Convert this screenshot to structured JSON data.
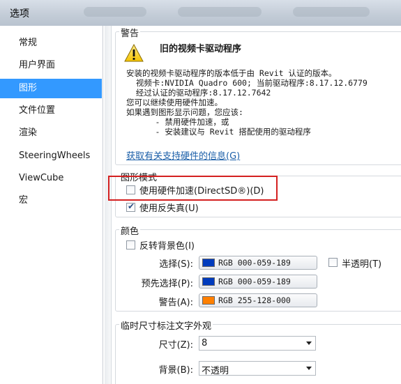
{
  "window": {
    "title": "选项"
  },
  "sidebar": {
    "items": [
      {
        "label": "常规",
        "selected": false
      },
      {
        "label": "用户界面",
        "selected": false
      },
      {
        "label": "图形",
        "selected": true
      },
      {
        "label": "文件位置",
        "selected": false
      },
      {
        "label": "渲染",
        "selected": false
      },
      {
        "label": "SteeringWheels",
        "selected": false
      },
      {
        "label": "ViewCube",
        "selected": false
      },
      {
        "label": "宏",
        "selected": false
      }
    ]
  },
  "warning": {
    "group_title": "警告",
    "icon": "warning-triangle-icon",
    "heading": "旧的视频卡驱动程序",
    "lines": [
      "安装的视频卡驱动程序的版本低于由 Revit 认证的版本。",
      "  视频卡:NVIDIA Quadro 600; 当前驱动程序:8.17.12.6779",
      "  经过认证的驱动程序:8.17.12.7642",
      "您可以继续使用硬件加速。",
      "如果遇到图形显示问题，您应该:",
      "      - 禁用硬件加速，或",
      "      - 安装建议与 Revit 搭配使用的驱动程序"
    ],
    "link": "获取有关支持硬件的信息(G)"
  },
  "graphics_mode": {
    "group_title": "图形模式",
    "hardware_accel": {
      "label": "使用硬件加速(DirectSD®)(D)",
      "checked": false
    },
    "antialias": {
      "label": "使用反失真(U)",
      "checked": true
    }
  },
  "colors": {
    "group_title": "颜色",
    "invert_bg": {
      "label": "反转背景色(I)",
      "checked": false
    },
    "selection": {
      "label": "选择(S):",
      "value": "RGB 000-059-189",
      "color": "#003bbd"
    },
    "semi_transparent": {
      "label": "半透明(T)",
      "checked": false
    },
    "preselection": {
      "label": "预先选择(P):",
      "value": "RGB 000-059-189",
      "color": "#003bbd"
    },
    "alert": {
      "label": "警告(A):",
      "value": "RGB 255-128-000",
      "color": "#ff8000"
    }
  },
  "temp_dimension": {
    "group_title": "临时尺寸标注文字外观",
    "size": {
      "label": "尺寸(Z):",
      "value": "8"
    },
    "background": {
      "label": "背景(B):",
      "value": "不透明"
    }
  },
  "highlight_color": "#d42020",
  "selection_color": "#3399ff",
  "link_color": "#1a5ea8"
}
